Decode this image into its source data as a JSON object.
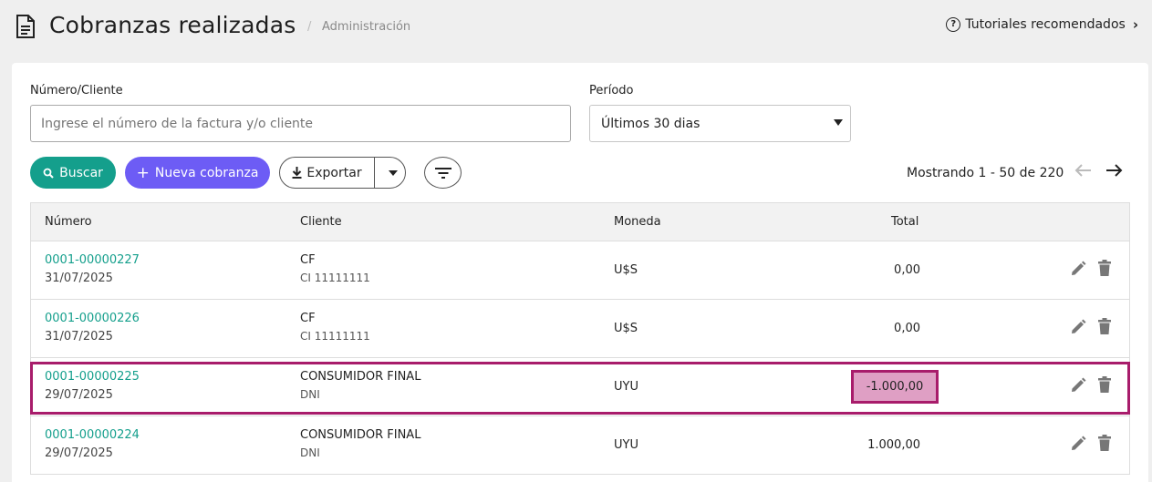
{
  "header": {
    "title": "Cobranzas realizadas",
    "separator": "/",
    "breadcrumb": "Administración",
    "tutorials": "Tutoriales recomendados",
    "tutorials_help_glyph": "?"
  },
  "filters": {
    "number_label": "Número/Cliente",
    "number_placeholder": "Ingrese el número de la factura y/o cliente",
    "number_value": "",
    "period_label": "Período",
    "period_value": "Últimos 30 dias"
  },
  "toolbar": {
    "search_label": "Buscar",
    "new_label": "Nueva cobranza",
    "new_prefix": "+",
    "export_label": "Exportar"
  },
  "pagination": {
    "text": "Mostrando 1 - 50 de 220"
  },
  "table": {
    "headers": {
      "number": "Número",
      "client": "Cliente",
      "currency": "Moneda",
      "total": "Total"
    },
    "rows": [
      {
        "number": "0001-00000227",
        "date": "31/07/2025",
        "client": "CF",
        "doc": "CI 11111111",
        "currency": "U$S",
        "total": "0,00"
      },
      {
        "number": "0001-00000226",
        "date": "31/07/2025",
        "client": "CF",
        "doc": "CI 11111111",
        "currency": "U$S",
        "total": "0,00"
      },
      {
        "number": "0001-00000225",
        "date": "29/07/2025",
        "client": "CONSUMIDOR FINAL",
        "doc": "DNI",
        "currency": "UYU",
        "total": "-1.000,00"
      },
      {
        "number": "0001-00000224",
        "date": "29/07/2025",
        "client": "CONSUMIDOR FINAL",
        "doc": "DNI",
        "currency": "UYU",
        "total": "1.000,00"
      }
    ]
  },
  "colors": {
    "accent_teal": "#149f8c",
    "accent_purple": "#6d5cf5",
    "highlight_border": "#a81c6b",
    "highlight_fill": "#df9fc4"
  }
}
